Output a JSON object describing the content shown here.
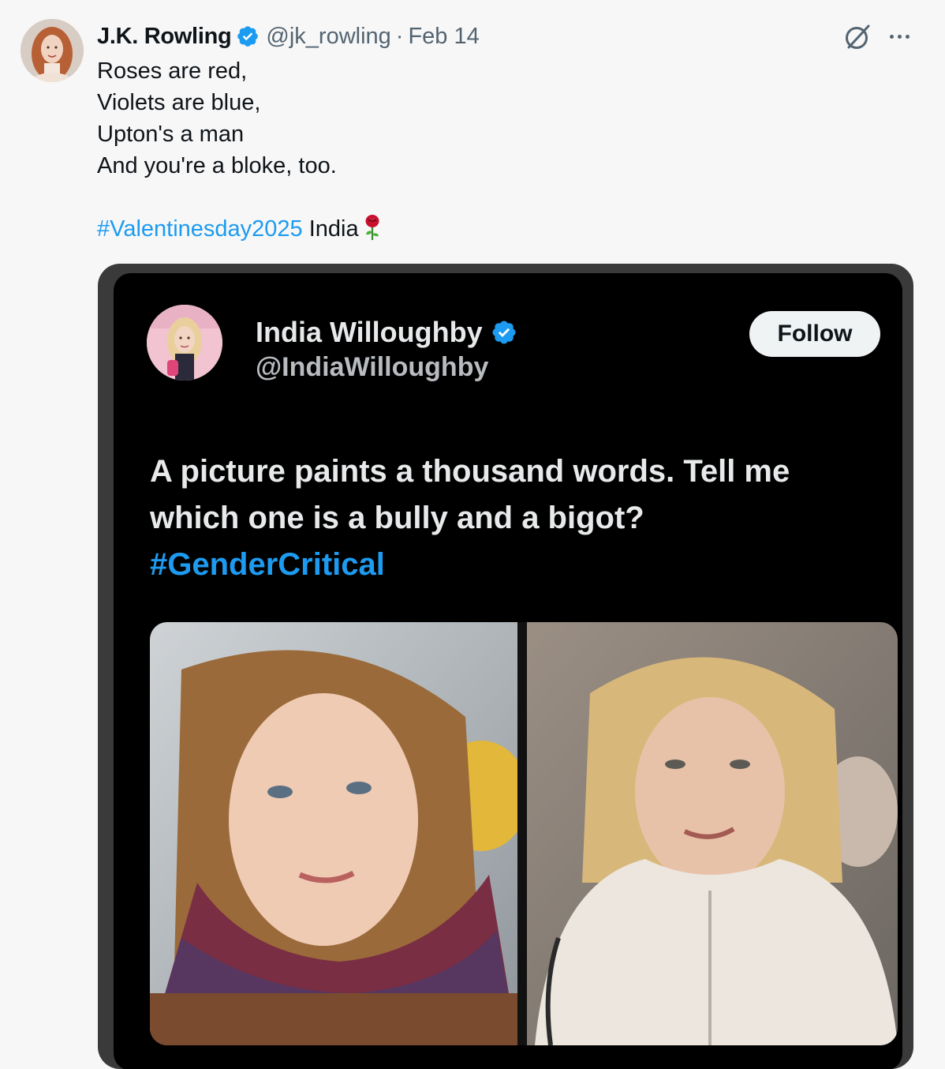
{
  "tweet": {
    "author_name": "J.K. Rowling",
    "author_handle": "@jk_rowling",
    "separator": "·",
    "date": "Feb 14",
    "lines": [
      "Roses are red,",
      "Violets are blue,",
      "Upton's a man",
      "And you're a bloke, too."
    ],
    "hashtag": "#Valentinesday2025",
    "after_hashtag": " India",
    "icons": {
      "verified": "verified-badge-icon",
      "grok": "grok-icon",
      "more": "more-icon",
      "rose": "rose-emoji-icon"
    }
  },
  "embedded": {
    "author_name": "India Willoughby",
    "author_handle": "@IndiaWilloughby",
    "follow_label": "Follow",
    "text_lines": [
      "A picture paints a thousand words. Tell me",
      "which one is a bully and a bigot?"
    ],
    "hashtag": "#GenderCritical"
  },
  "colors": {
    "link_blue": "#1d9bf0",
    "verified_blue": "#1d9bf0",
    "secondary_text": "#536471",
    "page_background": "#f7f7f7",
    "dark_card": "#000000"
  }
}
